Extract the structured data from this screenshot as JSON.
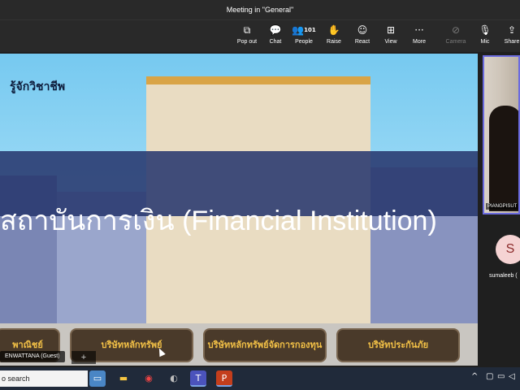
{
  "window": {
    "title": "Meeting in \"General\""
  },
  "toolbar": {
    "popout": "Pop out",
    "chat": "Chat",
    "people": "People",
    "people_count": "101",
    "raise": "Raise",
    "react": "React",
    "view": "View",
    "more": "More",
    "camera": "Camera",
    "mic": "Mic",
    "share": "Share",
    "icons": {
      "popout": "popout-icon",
      "chat": "chat-icon",
      "people": "people-icon",
      "raise": "hand-icon",
      "react": "smile-icon",
      "view": "grid-icon",
      "more": "ellipsis-icon",
      "camera": "camera-off-icon",
      "mic": "mic-off-icon",
      "share": "share-icon"
    }
  },
  "slide": {
    "heading": "รู้จักวิชาชีพ",
    "banner": "สถาบันการเงิน (Financial Institution)",
    "buttons": [
      "พาณิชย์",
      "บริษัทหลักทรัพย์",
      "บริษัทหลักทรัพย์จัดการกองทุน",
      "บริษัทประกันภัย"
    ]
  },
  "participants": {
    "video_name": "PIANGPISUT",
    "avatar_initial": "S",
    "avatar_name": "sumaleeb (",
    "guest_label": "ENWATTANA (Guest)",
    "add_symbol": "+"
  },
  "taskbar": {
    "search_text": "o search",
    "apps": [
      "tablet-icon",
      "file-explorer-icon",
      "chrome-icon",
      "app-icon",
      "teams-icon",
      "powerpoint-icon"
    ],
    "app_letters": {
      "teams": "T",
      "powerpoint": "P"
    }
  },
  "colors": {
    "accent_purple": "#6b6bdf",
    "slide_button_text": "#f2c046",
    "banner": "#28386e",
    "avatar_bg": "#f5d3d3"
  }
}
